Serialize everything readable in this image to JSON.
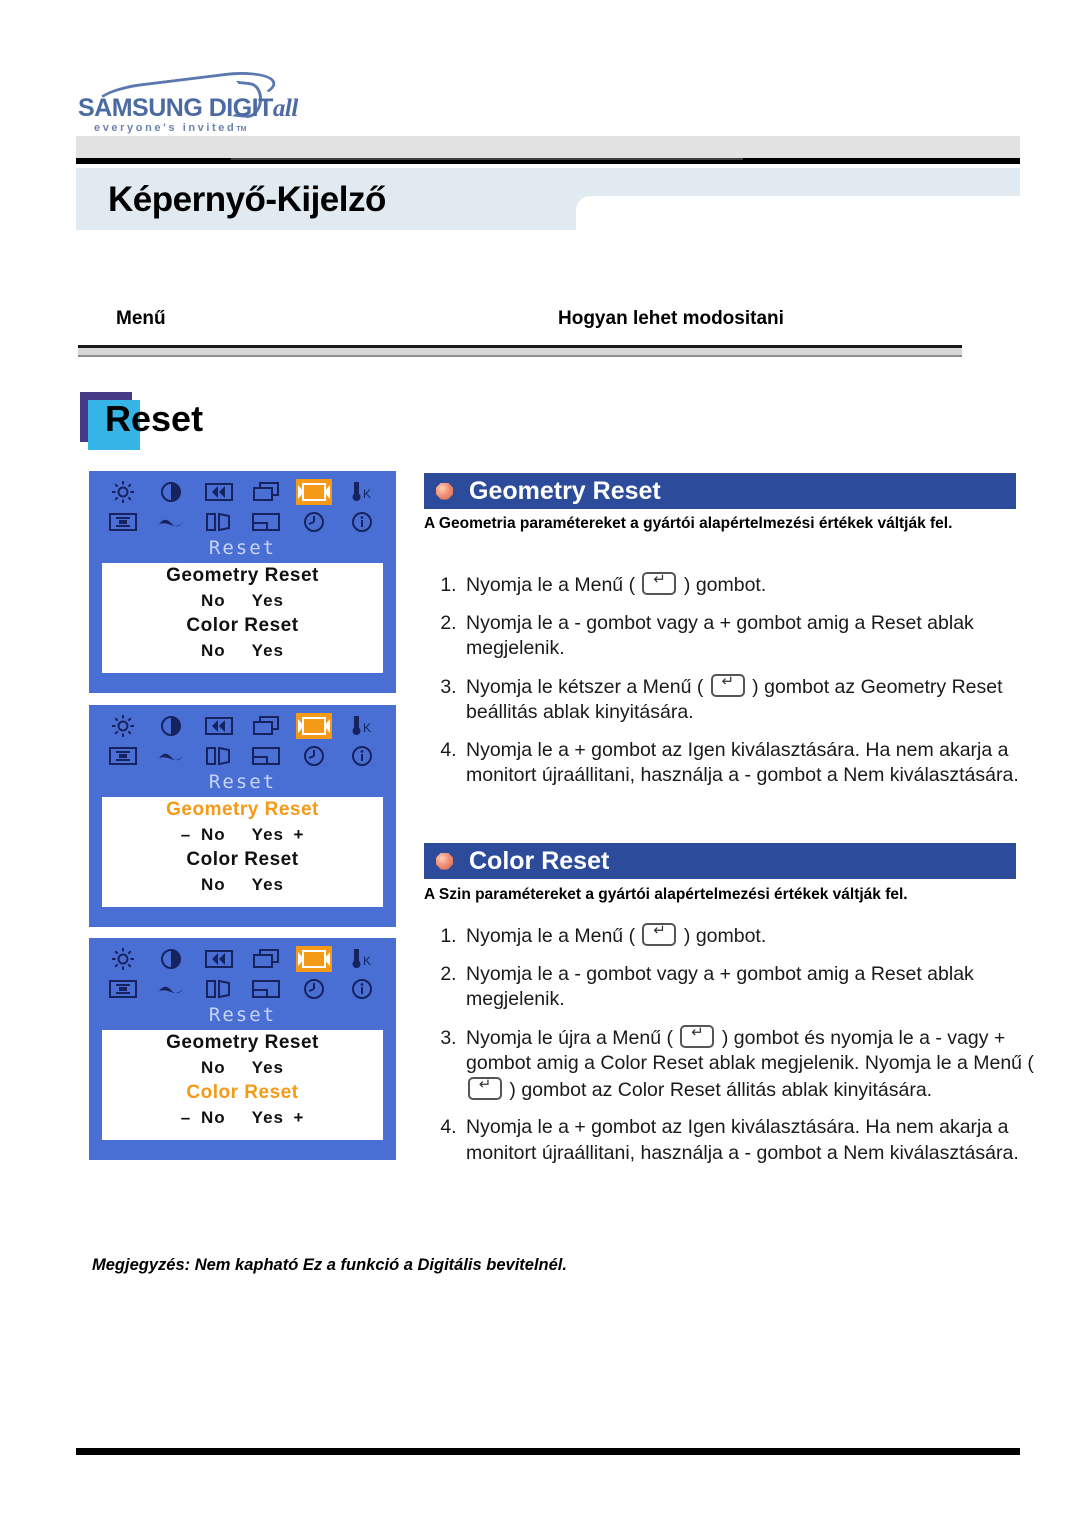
{
  "logo": {
    "brand_main": "SAMSUNG DIGIT",
    "brand_italic": "all",
    "tagline": "everyone's invited",
    "trademark": "TM"
  },
  "header": {
    "page_title": "Képernyő-Kijelző",
    "column_menu": "Menű",
    "column_how": "Hogyan lehet modositani"
  },
  "section": {
    "title": "Reset",
    "accent_square": "#35b4e8",
    "accent_shadow": "#453a86"
  },
  "osd": {
    "panel_bg": "#4a6fd4",
    "highlight": "#f59a16",
    "menu_title": "Reset",
    "icons": [
      {
        "name": "brightness-icon",
        "selected": false
      },
      {
        "name": "contrast-icon",
        "selected": false
      },
      {
        "name": "h-position-icon",
        "selected": false
      },
      {
        "name": "h-size-icon",
        "selected": false
      },
      {
        "name": "reset-icon",
        "selected": true
      },
      {
        "name": "color-temperature-icon",
        "selected": false
      },
      {
        "name": "pincushion-icon",
        "selected": false
      },
      {
        "name": "trapezoid-icon",
        "selected": false
      },
      {
        "name": "parallelogram-icon",
        "selected": false
      },
      {
        "name": "rotation-icon",
        "selected": false
      },
      {
        "name": "osd-time-icon",
        "selected": false
      },
      {
        "name": "information-icon",
        "selected": false
      }
    ],
    "screens": [
      {
        "id": "osd-screen-1",
        "rows": [
          {
            "label": "Geometry Reset",
            "highlighted": false,
            "minus": "",
            "no": "No",
            "yes": "Yes",
            "plus": ""
          },
          {
            "label": "Color Reset",
            "highlighted": false,
            "minus": "",
            "no": "No",
            "yes": "Yes",
            "plus": ""
          }
        ]
      },
      {
        "id": "osd-screen-2",
        "rows": [
          {
            "label": "Geometry Reset",
            "highlighted": true,
            "minus": "–",
            "no": "No",
            "yes": "Yes",
            "plus": "+"
          },
          {
            "label": "Color Reset",
            "highlighted": false,
            "minus": "",
            "no": "No",
            "yes": "Yes",
            "plus": ""
          }
        ]
      },
      {
        "id": "osd-screen-3",
        "rows": [
          {
            "label": "Geometry Reset",
            "highlighted": false,
            "minus": "",
            "no": "No",
            "yes": "Yes",
            "plus": ""
          },
          {
            "label": "Color Reset",
            "highlighted": true,
            "minus": "–",
            "no": "No",
            "yes": "Yes",
            "plus": "+"
          }
        ]
      }
    ]
  },
  "geometry_reset": {
    "heading": "Geometry Reset",
    "description": "A Geometria paramétereket a gyártói alapértelmezési értékek váltják fel.",
    "steps": [
      {
        "pre": "Nyomja le a Menű  ( ",
        "post": " ) gombot.",
        "button": true
      },
      {
        "pre": "Nyomja le a - gombot vagy a + gombot amig a Reset ablak megjelenik.",
        "post": "",
        "button": false
      },
      {
        "pre": "Nyomja le kétszer a Menű ( ",
        "post": " ) gombot az Geometry Reset beállitás ablak kinyitására.",
        "button": true
      },
      {
        "pre": "Nyomja le a + gombot az Igen kiválasztására. Ha nem akarja a monitort újraállitani, használja a - gombot a Nem kiválasztására.",
        "post": "",
        "button": false
      }
    ]
  },
  "color_reset": {
    "heading": "Color Reset",
    "description": "A Szin paramétereket a gyártói alapértelmezési értékek váltják fel.",
    "steps": [
      {
        "pre": "Nyomja le a Menű  ( ",
        "post": " ) gombot.",
        "button": true
      },
      {
        "pre": "Nyomja le a - gombot vagy a + gombot amig a Reset ablak megjelenik.",
        "post": "",
        "button": false
      },
      {
        "pre": "Nyomja le újra a Menű ( ",
        "mid": " ) gombot és nyomja le a - vagy + gombot amig a Color Reset ablak megjelenik. Nyomja le a Menű ( ",
        "post": " ) gombot az Color Reset állitás ablak kinyitására.",
        "button": true,
        "button2": true
      },
      {
        "pre": "Nyomja le a + gombot az Igen kiválasztására. Ha nem akarja a monitort újraállitani, használja a - gombot a Nem kiválasztására.",
        "post": "",
        "button": false
      }
    ]
  },
  "note": "Megjegyzés: Nem kapható Ez a funkció a Digitális bevitelnél."
}
